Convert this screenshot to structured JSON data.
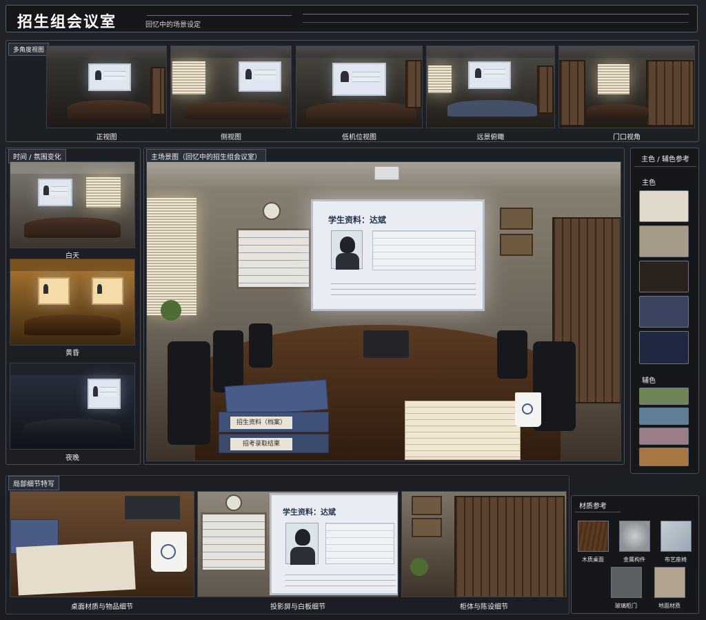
{
  "header": {
    "title": "招生组会议室",
    "subtitle": "回忆中的场景设定"
  },
  "views": {
    "section_label": "多角度视图",
    "items": [
      {
        "label": "正视图"
      },
      {
        "label": "侧视图"
      },
      {
        "label": "低机位视图"
      },
      {
        "label": "远景俯瞰"
      },
      {
        "label": "门口视角"
      }
    ]
  },
  "time": {
    "section_label": "时间 / 氛围变化",
    "items": [
      {
        "label": "白天"
      },
      {
        "label": "黄昏"
      },
      {
        "label": "夜晚"
      }
    ]
  },
  "main": {
    "section_label": "主场景图（回忆中的招生组会议室）",
    "screen_title": "学生资料：达斌",
    "binder_label_1": "招生资料（档案）",
    "binder_label_2": "招考录取结果"
  },
  "colors": {
    "section_label": "主色 / 辅色参考",
    "primary_label": "主色",
    "secondary_label": "辅色",
    "primary": [
      "#e1d9cc",
      "#a69a88",
      "#2c221d",
      "#3a4360",
      "#1f2840"
    ],
    "secondary": [
      "#6f8556",
      "#5f7f98",
      "#9a7d86",
      "#a77843"
    ]
  },
  "details": {
    "section_label": "局部细节特写",
    "items": [
      {
        "label": "桌面材质与物品细节"
      },
      {
        "label": "投影屏与白板细节"
      },
      {
        "label": "柜体与陈设细节"
      }
    ]
  },
  "materials": {
    "section_label": "材质参考",
    "items": [
      {
        "label": "木质桌面",
        "color": "#5b3a22"
      },
      {
        "label": "金属构件",
        "color": "#8e9196"
      },
      {
        "label": "布艺座椅",
        "color": "#9aa7b3"
      },
      {
        "label": "玻璃柜门",
        "color": "#5d6063"
      },
      {
        "label": "地面材质",
        "color": "#b3a391"
      }
    ]
  }
}
